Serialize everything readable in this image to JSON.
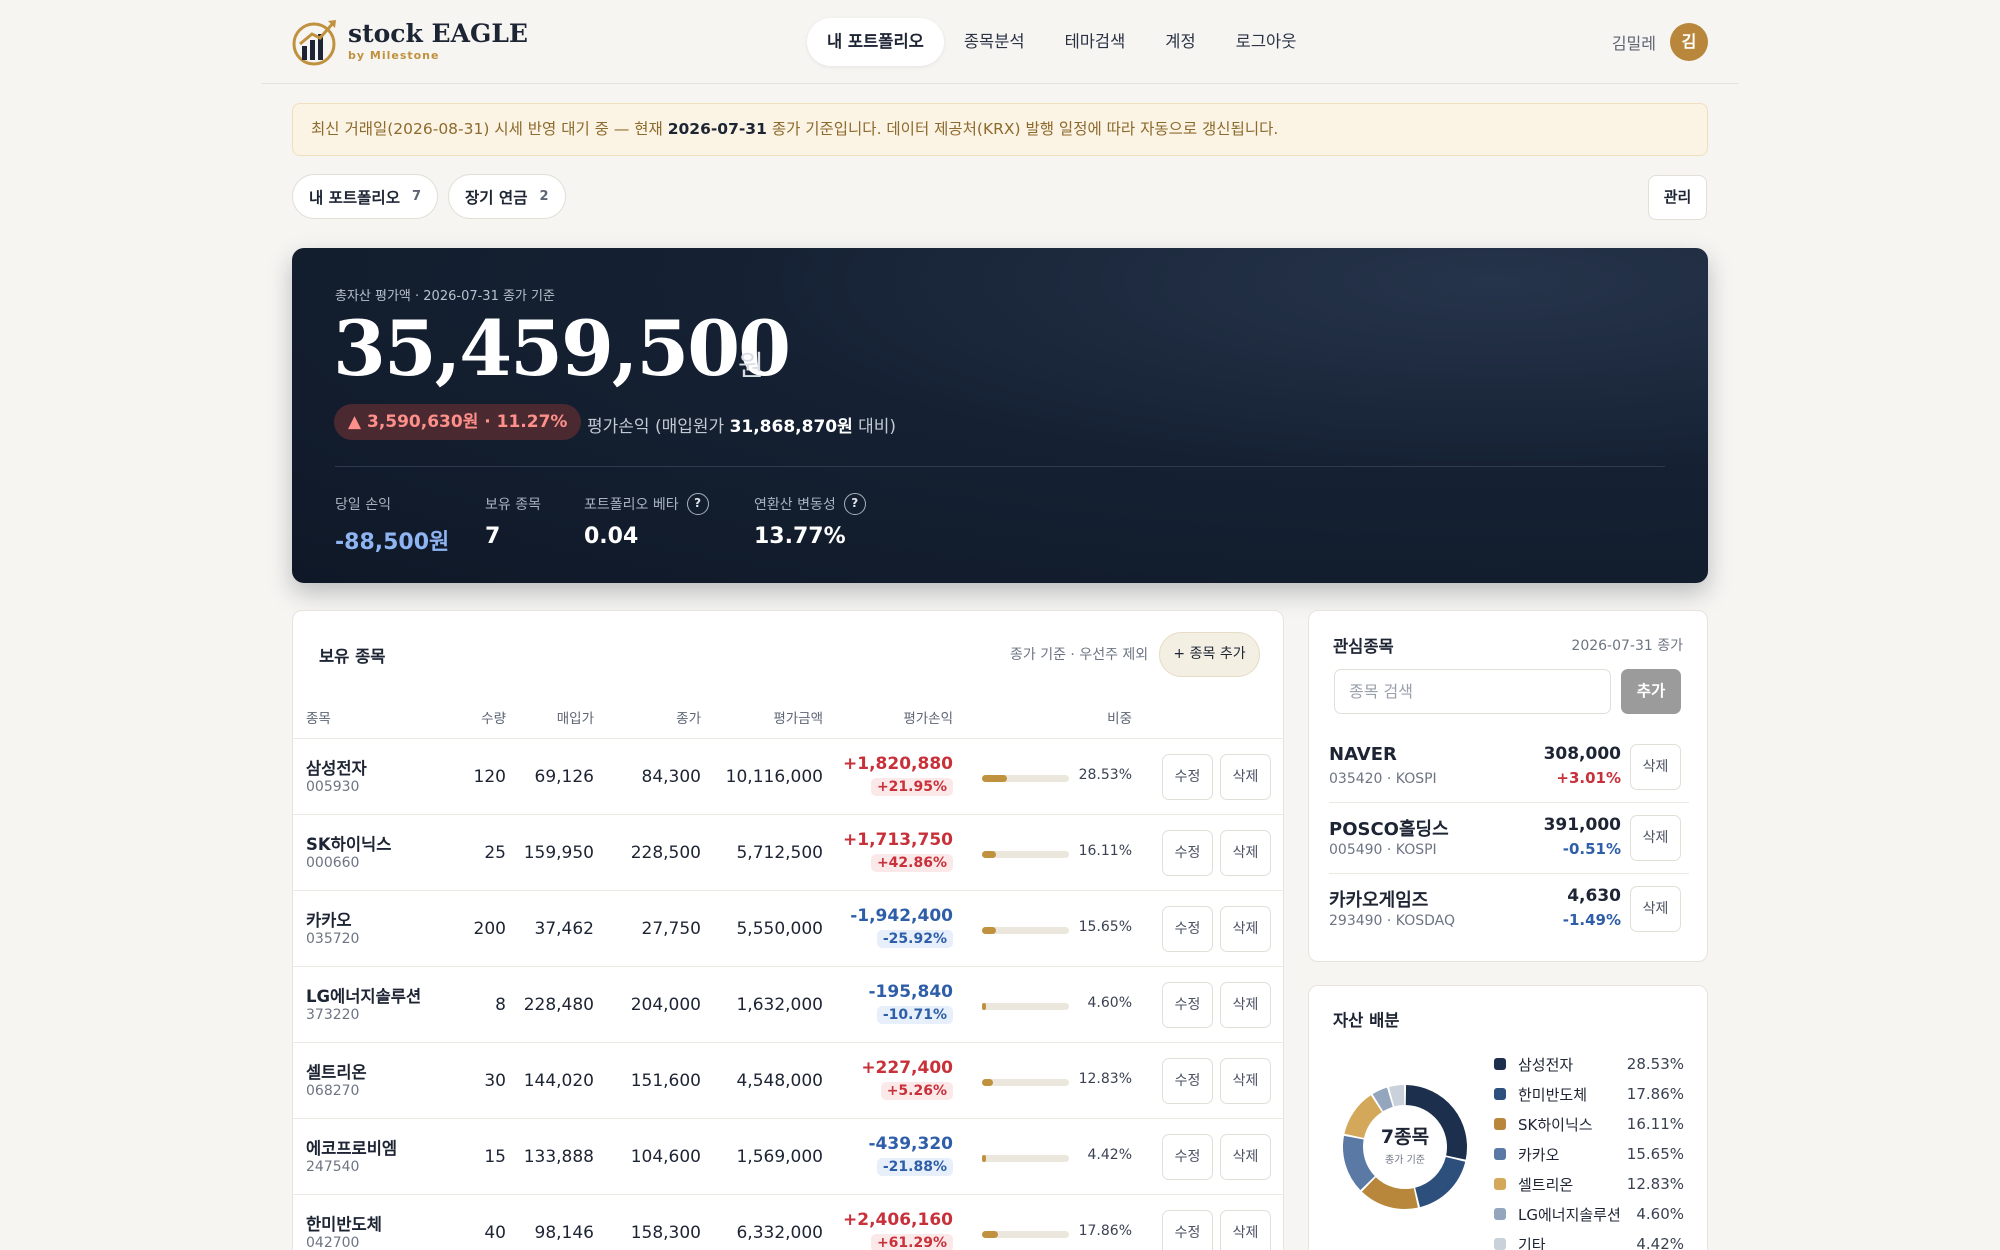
{
  "brand": {
    "name": "stock EAGLE",
    "sub": "by Milestone"
  },
  "menu": [
    {
      "label": "내 포트폴리오",
      "active": true
    },
    {
      "label": "종목분석",
      "active": false
    },
    {
      "label": "테마검색",
      "active": false
    },
    {
      "label": "계정",
      "active": false
    },
    {
      "label": "로그아웃",
      "active": false
    }
  ],
  "user": {
    "name": "김밀레",
    "initial": "김"
  },
  "notice": {
    "pre": "최신 거래일(2026-08-31) 시세 반영 대기 중 — 현재 ",
    "date": "2026-07-31",
    "post": " 종가 기준입니다. 데이터 제공처(KRX) 발행 일정에 따라 자동으로 갱신됩니다."
  },
  "portfolio_tabs": [
    {
      "label": "내 포트폴리오",
      "count": "7"
    },
    {
      "label": "장기 연금",
      "count": "2"
    }
  ],
  "manage_label": "관리",
  "summary": {
    "label": "총자산 평가액 · 2026-07-31 종가 기준",
    "total": "35,459,500",
    "unit": "원",
    "gain": "▲ 3,590,630원 · 11.27%",
    "gain_desc_pre": "평가손익 (매입원가 ",
    "gain_cost": "31,868,870원",
    "gain_desc_post": " 대비)",
    "stats": [
      {
        "label": "당일 손익",
        "value": "-88,500원",
        "help": false,
        "neg": true
      },
      {
        "label": "보유 종목",
        "value": "7",
        "help": false,
        "neg": false
      },
      {
        "label": "포트폴리오 베타",
        "value": "0.04",
        "help": true,
        "neg": false
      },
      {
        "label": "연환산 변동성",
        "value": "13.77%",
        "help": true,
        "neg": false
      }
    ],
    "help_glyph": "?"
  },
  "holdings": {
    "title": "보유 종목",
    "meta": "종가 기준 · 우선주 제외",
    "add_label": "+ 종목 추가",
    "columns": [
      "종목",
      "수량",
      "매입가",
      "종가",
      "평가금액",
      "평가손익",
      "비중"
    ],
    "edit_label": "수정",
    "delete_label": "삭제",
    "rows": [
      {
        "name": "삼성전자",
        "code": "005930",
        "qty": "120",
        "buy": "69,126",
        "close": "84,300",
        "value": "10,116,000",
        "pl": "+1,820,880",
        "pl_pct": "+21.95%",
        "dir": "pos",
        "weight": "28.53%",
        "weight_num": 28.53
      },
      {
        "name": "SK하이닉스",
        "code": "000660",
        "qty": "25",
        "buy": "159,950",
        "close": "228,500",
        "value": "5,712,500",
        "pl": "+1,713,750",
        "pl_pct": "+42.86%",
        "dir": "pos",
        "weight": "16.11%",
        "weight_num": 16.11
      },
      {
        "name": "카카오",
        "code": "035720",
        "qty": "200",
        "buy": "37,462",
        "close": "27,750",
        "value": "5,550,000",
        "pl": "-1,942,400",
        "pl_pct": "-25.92%",
        "dir": "neg",
        "weight": "15.65%",
        "weight_num": 15.65
      },
      {
        "name": "LG에너지솔루션",
        "code": "373220",
        "qty": "8",
        "buy": "228,480",
        "close": "204,000",
        "value": "1,632,000",
        "pl": "-195,840",
        "pl_pct": "-10.71%",
        "dir": "neg",
        "weight": "4.60%",
        "weight_num": 4.6
      },
      {
        "name": "셀트리온",
        "code": "068270",
        "qty": "30",
        "buy": "144,020",
        "close": "151,600",
        "value": "4,548,000",
        "pl": "+227,400",
        "pl_pct": "+5.26%",
        "dir": "pos",
        "weight": "12.83%",
        "weight_num": 12.83
      },
      {
        "name": "에코프로비엠",
        "code": "247540",
        "qty": "15",
        "buy": "133,888",
        "close": "104,600",
        "value": "1,569,000",
        "pl": "-439,320",
        "pl_pct": "-21.88%",
        "dir": "neg",
        "weight": "4.42%",
        "weight_num": 4.42
      },
      {
        "name": "한미반도체",
        "code": "042700",
        "qty": "40",
        "buy": "98,146",
        "close": "158,300",
        "value": "6,332,000",
        "pl": "+2,406,160",
        "pl_pct": "+61.29%",
        "dir": "pos",
        "weight": "17.86%",
        "weight_num": 17.86
      }
    ]
  },
  "watchlist": {
    "title": "관심종목",
    "date": "2026-07-31 종가",
    "search_placeholder": "종목 검색",
    "add_label": "추가",
    "delete_label": "삭제",
    "items": [
      {
        "name": "NAVER",
        "code": "035420 · KOSPI",
        "price": "308,000",
        "change": "+3.01%",
        "dir": "pos"
      },
      {
        "name": "POSCO홀딩스",
        "code": "005490 · KOSPI",
        "price": "391,000",
        "change": "-0.51%",
        "dir": "neg"
      },
      {
        "name": "카카오게임즈",
        "code": "293490 · KOSDAQ",
        "price": "4,630",
        "change": "-1.49%",
        "dir": "neg"
      }
    ]
  },
  "allocation": {
    "title": "자산 배분",
    "center_big": "7종목",
    "center_small": "종가 기준",
    "items": [
      {
        "name": "삼성전자",
        "value": "28.53%",
        "pct": 28.53,
        "color": "#1c2f4d"
      },
      {
        "name": "한미반도체",
        "value": "17.86%",
        "pct": 17.86,
        "color": "#2c4f7c"
      },
      {
        "name": "SK하이닉스",
        "value": "16.11%",
        "pct": 16.11,
        "color": "#b8873b"
      },
      {
        "name": "카카오",
        "value": "15.65%",
        "pct": 15.65,
        "color": "#5a7aa5"
      },
      {
        "name": "셀트리온",
        "value": "12.83%",
        "pct": 12.83,
        "color": "#d4a85a"
      },
      {
        "name": "LG에너지솔루션",
        "value": "4.60%",
        "pct": 4.6,
        "color": "#94a6bd"
      },
      {
        "name": "기타",
        "value": "4.42%",
        "pct": 4.42,
        "color": "#c9d1db"
      }
    ]
  }
}
